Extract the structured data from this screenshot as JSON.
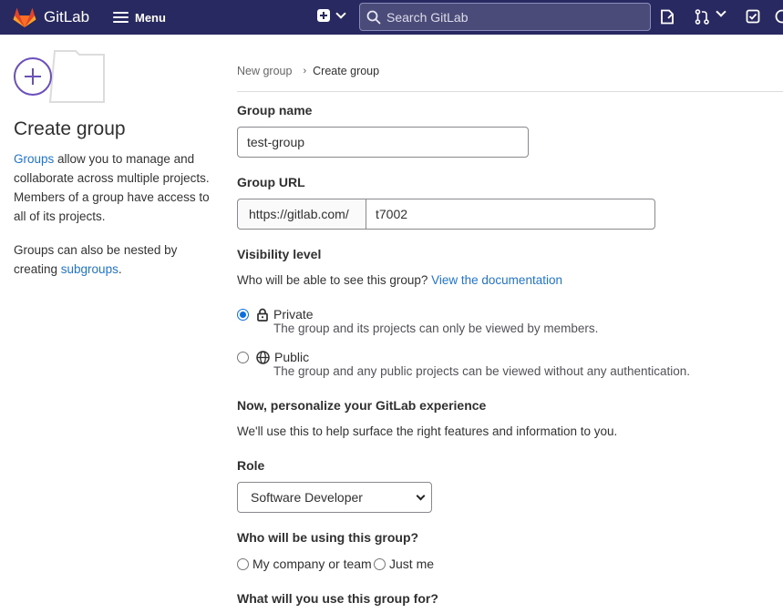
{
  "navbar": {
    "brand": "GitLab",
    "menu_label": "Menu",
    "search_placeholder": "Search GitLab",
    "bg_color": "#292961"
  },
  "sidebar": {
    "title": "Create group",
    "desc1_link": "Groups",
    "desc1_text": " allow you to manage and collaborate across multiple projects. Members of a group have access to all of its projects.",
    "desc2_text": "Groups can also be nested by creating ",
    "desc2_link": "subgroups",
    "desc2_suffix": "."
  },
  "breadcrumb": {
    "items": [
      "New group",
      "Create group"
    ]
  },
  "form": {
    "group_name_label": "Group name",
    "group_name_value": "test-group",
    "group_url_label": "Group URL",
    "group_url_prefix": "https://gitlab.com/",
    "group_url_value": "t7002",
    "visibility_label": "Visibility level",
    "visibility_help": "Who will be able to see this group? ",
    "visibility_help_link": "View the documentation",
    "visibility_options": [
      {
        "label": "Private",
        "description": "The group and its projects can only be viewed by members.",
        "checked": true,
        "icon": "lock-icon"
      },
      {
        "label": "Public",
        "description": "The group and any public projects can be viewed without any authentication.",
        "checked": false,
        "icon": "globe-icon"
      }
    ],
    "personalize_heading": "Now, personalize your GitLab experience",
    "personalize_help": "We'll use this to help surface the right features and information to you.",
    "role_label": "Role",
    "role_value": "Software Developer",
    "using_label": "Who will be using this group?",
    "using_options": [
      "My company or team",
      "Just me"
    ],
    "purpose_label": "What will you use this group for?"
  },
  "colors": {
    "link": "#1f75cb",
    "accent_purple": "#6b4fbb",
    "radio_checked": "#0b6ee0"
  }
}
